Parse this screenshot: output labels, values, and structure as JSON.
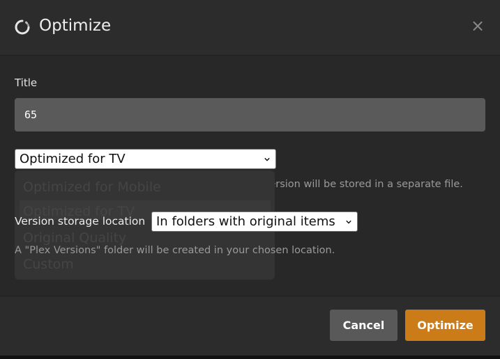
{
  "dialog": {
    "title": "Optimize",
    "icon": "loading-spinner-icon",
    "close_glyph": "×",
    "close_icon": "close-icon"
  },
  "form": {
    "title_label": "Title",
    "title_value": "65",
    "quality": {
      "selected": "Optimized for TV",
      "options": [
        "Optimized for Mobile",
        "Optimized for TV",
        "Original Quality",
        "Custom"
      ],
      "highlighted": "Optimized for TV",
      "description": "Plex will convert your media to this quality. Each version will be stored in a separate file."
    },
    "storage": {
      "label": "Version storage location",
      "selected": "In folders with original items",
      "description": "A \"Plex Versions\" folder will be created in your chosen location."
    }
  },
  "footer": {
    "cancel_label": "Cancel",
    "optimize_label": "Optimize"
  },
  "colors": {
    "accent": "#cc7b19",
    "background": "#282828",
    "input_background": "#5a5a5a",
    "secondary_button": "#595959"
  }
}
